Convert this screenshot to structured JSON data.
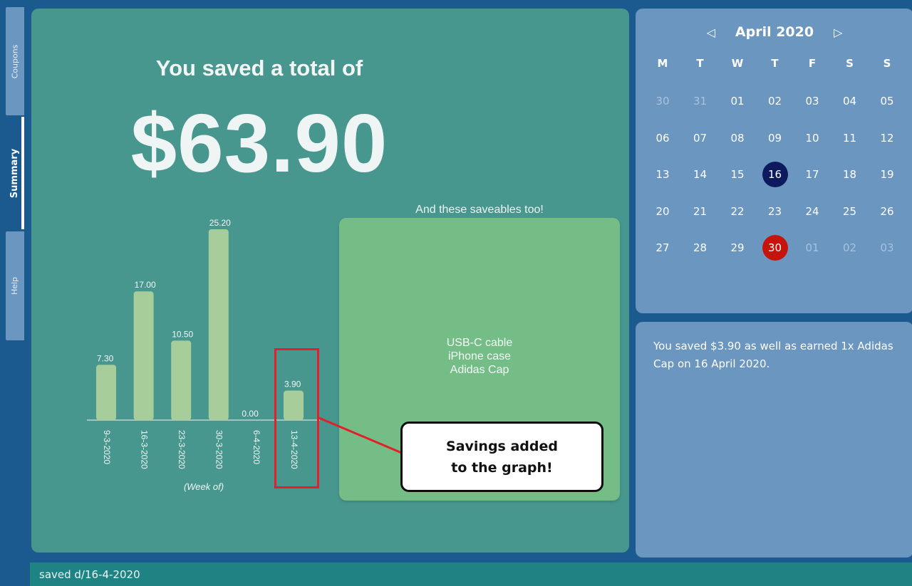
{
  "tabs": [
    {
      "label": "Coupons",
      "active": false
    },
    {
      "label": "Summary",
      "active": true
    },
    {
      "label": "Help",
      "active": false
    }
  ],
  "summary": {
    "headline": "You saved a total of",
    "total": "$63.90"
  },
  "chart_data": {
    "type": "bar",
    "categories": [
      "9-3-2020",
      "16-3-2020",
      "23-3-2020",
      "30-3-2020",
      "6-4-2020",
      "13-4-2020"
    ],
    "values": [
      7.3,
      17.0,
      10.5,
      25.2,
      0.0,
      3.9
    ],
    "value_labels": [
      "7.30",
      "17.00",
      "10.50",
      "25.20",
      "0.00",
      "3.90"
    ],
    "xlabel": "(Week of)",
    "ylabel": "",
    "ylim": [
      0,
      25.2
    ],
    "bar_color": "#a6cd9a"
  },
  "saveables": {
    "title": "And these saveables too!",
    "items": [
      "USB-C cable",
      "iPhone case",
      "Adidas Cap"
    ]
  },
  "callout": {
    "line1": "Savings added",
    "line2": "to the graph!"
  },
  "calendar": {
    "month_label": "April 2020",
    "prev_icon": "◁",
    "next_icon": "▷",
    "weekdays": [
      "M",
      "T",
      "W",
      "T",
      "F",
      "S",
      "S"
    ],
    "weeks": [
      [
        {
          "d": "30",
          "m": true
        },
        {
          "d": "31",
          "m": true
        },
        {
          "d": "01"
        },
        {
          "d": "02"
        },
        {
          "d": "03"
        },
        {
          "d": "04"
        },
        {
          "d": "05"
        }
      ],
      [
        {
          "d": "06"
        },
        {
          "d": "07"
        },
        {
          "d": "08"
        },
        {
          "d": "09"
        },
        {
          "d": "10"
        },
        {
          "d": "11"
        },
        {
          "d": "12"
        }
      ],
      [
        {
          "d": "13"
        },
        {
          "d": "14"
        },
        {
          "d": "15"
        },
        {
          "d": "16",
          "today": true
        },
        {
          "d": "17"
        },
        {
          "d": "18"
        },
        {
          "d": "19"
        }
      ],
      [
        {
          "d": "20"
        },
        {
          "d": "21"
        },
        {
          "d": "22"
        },
        {
          "d": "23"
        },
        {
          "d": "24"
        },
        {
          "d": "25"
        },
        {
          "d": "26"
        }
      ],
      [
        {
          "d": "27"
        },
        {
          "d": "28"
        },
        {
          "d": "29"
        },
        {
          "d": "30",
          "selected": true
        },
        {
          "d": "01",
          "m": true
        },
        {
          "d": "02",
          "m": true
        },
        {
          "d": "03",
          "m": true
        }
      ]
    ],
    "colors": {
      "today": "#0e1a5e",
      "selected": "#c4140c"
    }
  },
  "details": {
    "text": "You saved $3.90 as well as earned 1x Adidas Cap on 16 April 2020."
  },
  "command": {
    "value": "saved d/16-4-2020"
  },
  "colors": {
    "background": "#1b5a8e",
    "main_panel": "#47978e",
    "saveables_panel": "#74bd87",
    "side_panel": "#6b96c0",
    "command_bar": "#1f8384",
    "highlight": "#e3202a"
  }
}
